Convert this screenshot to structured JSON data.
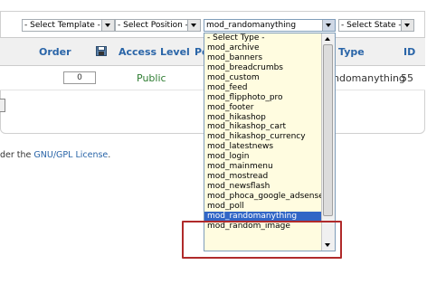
{
  "filters": {
    "template": "- Select Template -",
    "position": "- Select Position -",
    "type": "mod_randomanything",
    "state": "- Select State -"
  },
  "table": {
    "headers": {
      "order": "Order",
      "access": "Access Level",
      "position_partial": "Po",
      "type": "Type",
      "id": "ID"
    },
    "row": {
      "order_value": "0",
      "access": "Public",
      "type_partial": "ndomanything",
      "id": "55"
    }
  },
  "footer": {
    "text_prefix": "der the ",
    "link": "GNU/GPL License",
    "text_suffix": "."
  },
  "dropdown": {
    "options": [
      "- Select Type -",
      "mod_archive",
      "mod_banners",
      "mod_breadcrumbs",
      "mod_custom",
      "mod_feed",
      "mod_flipphoto_pro",
      "mod_footer",
      "mod_hikashop",
      "mod_hikashop_cart",
      "mod_hikashop_currency",
      "mod_latestnews",
      "mod_login",
      "mod_mainmenu",
      "mod_mostread",
      "mod_newsflash",
      "mod_phoca_google_adsense",
      "mod_poll",
      "mod_randomanything",
      "mod_random_image"
    ],
    "selected_index": 18
  },
  "colors": {
    "accent": "#2a65a8",
    "selection": "#3166c6",
    "highlight_border": "#b02a2a",
    "dropdown_bg": "#fffce0"
  }
}
